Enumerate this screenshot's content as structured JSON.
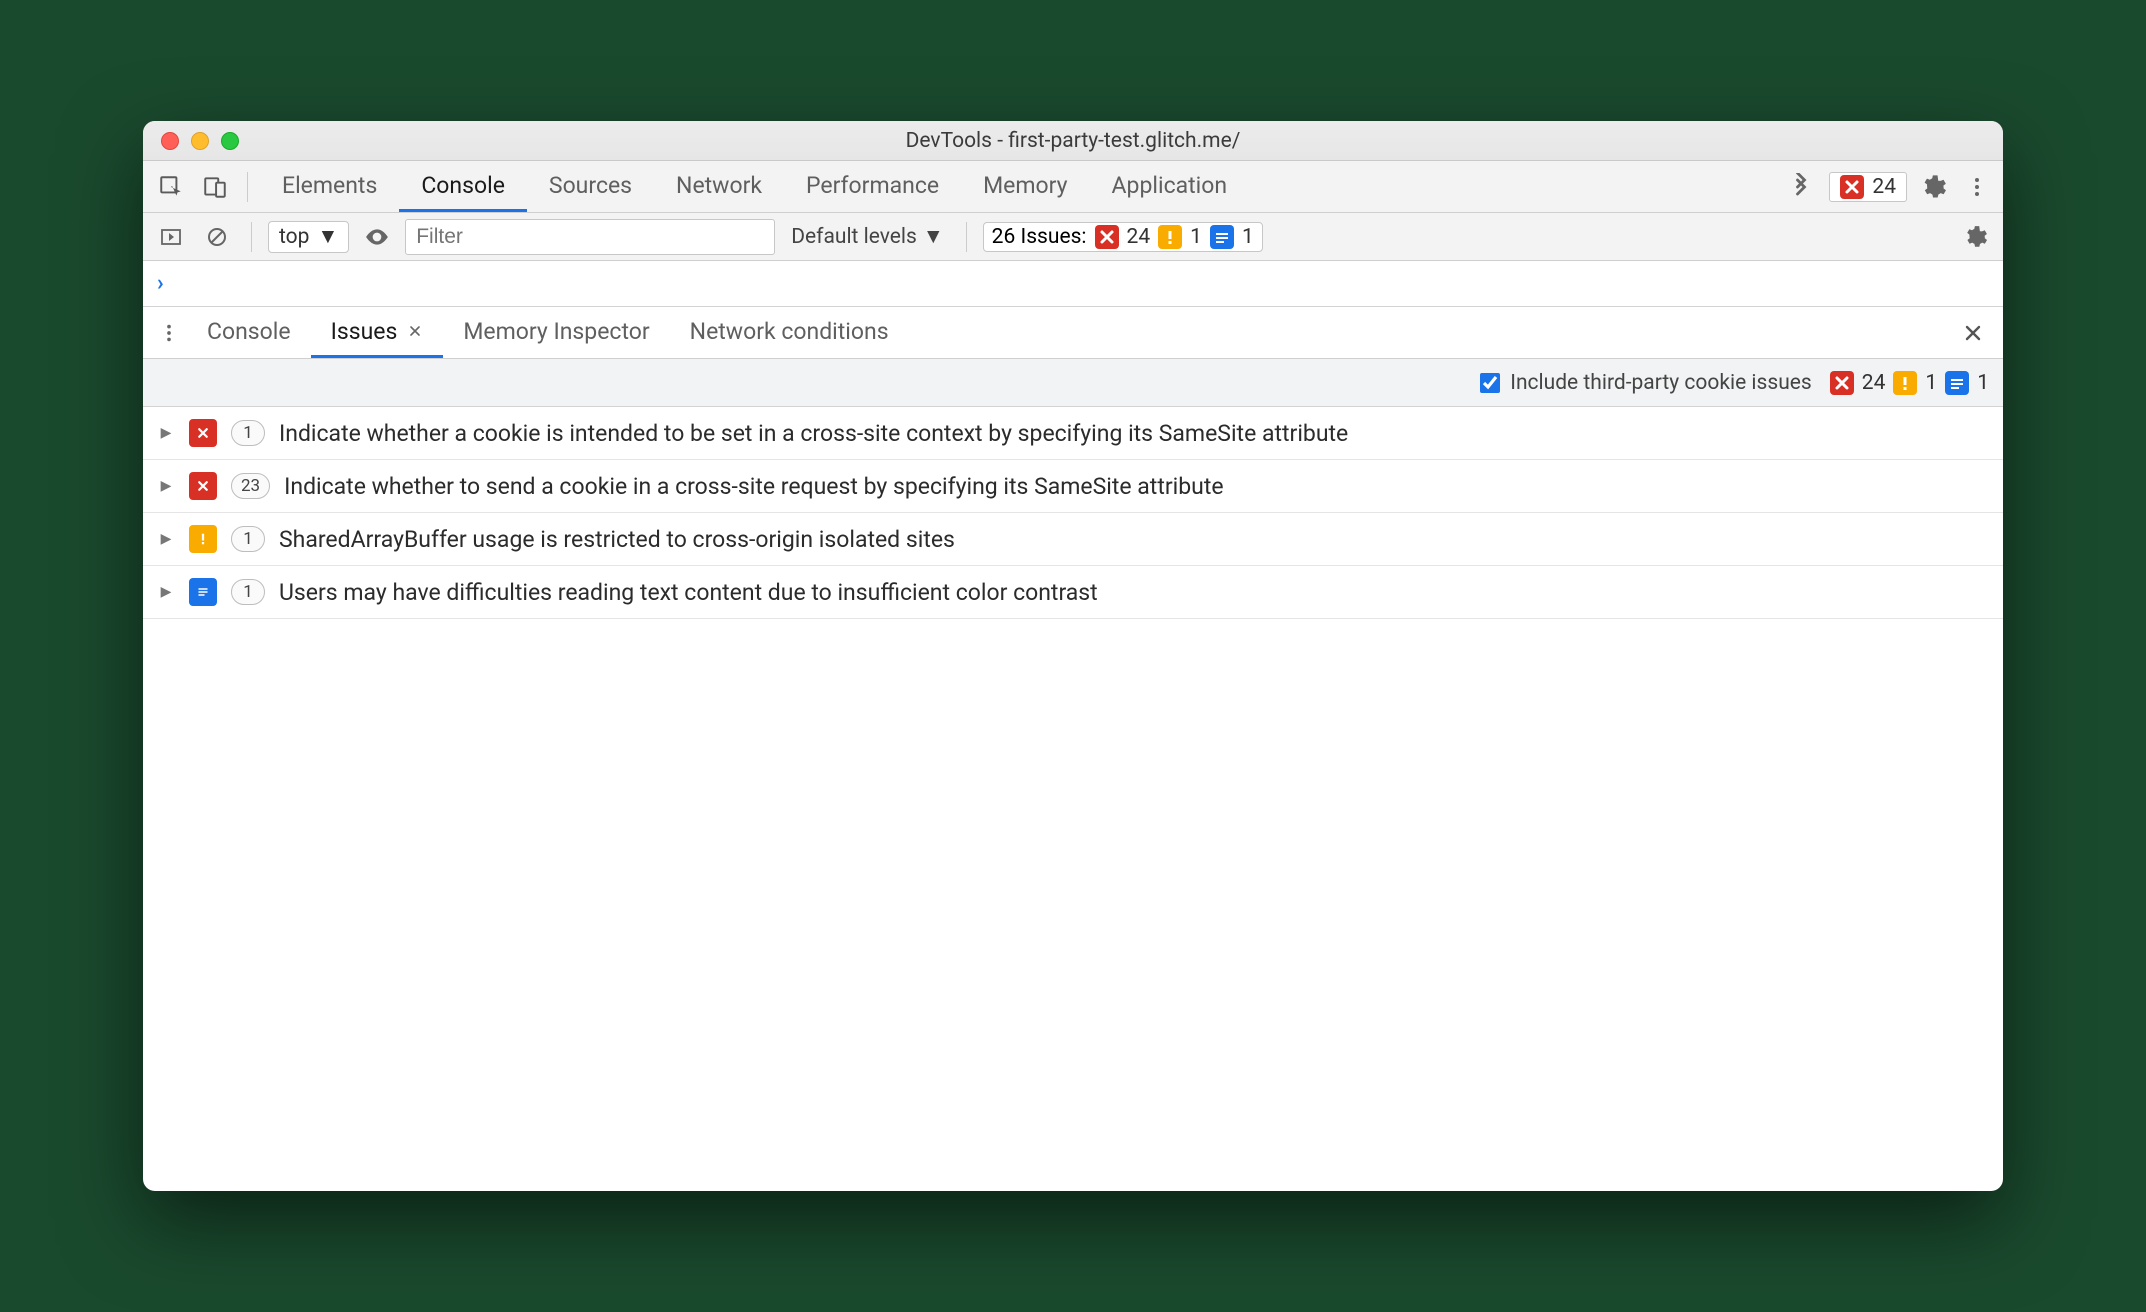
{
  "window": {
    "title": "DevTools - first-party-test.glitch.me/"
  },
  "main_tabs": {
    "items": [
      "Elements",
      "Console",
      "Sources",
      "Network",
      "Performance",
      "Memory",
      "Application"
    ],
    "active_index": 1,
    "error_badge_count": "24"
  },
  "console_toolbar": {
    "context": "top",
    "filter_placeholder": "Filter",
    "levels_label": "Default levels",
    "issues_label": "26 Issues:",
    "issues_err": "24",
    "issues_warn": "1",
    "issues_info": "1"
  },
  "drawer_tabs": {
    "items": [
      "Console",
      "Issues",
      "Memory Inspector",
      "Network conditions"
    ],
    "active_index": 1
  },
  "issues_header": {
    "checkbox_label": "Include third-party cookie issues",
    "checkbox_checked": true,
    "err": "24",
    "warn": "1",
    "info": "1"
  },
  "issues": [
    {
      "kind": "error",
      "count": "1",
      "title": "Indicate whether a cookie is intended to be set in a cross-site context by specifying its SameSite attribute"
    },
    {
      "kind": "error",
      "count": "23",
      "title": "Indicate whether to send a cookie in a cross-site request by specifying its SameSite attribute"
    },
    {
      "kind": "warning",
      "count": "1",
      "title": "SharedArrayBuffer usage is restricted to cross-origin isolated sites"
    },
    {
      "kind": "info",
      "count": "1",
      "title": "Users may have difficulties reading text content due to insufficient color contrast"
    }
  ]
}
